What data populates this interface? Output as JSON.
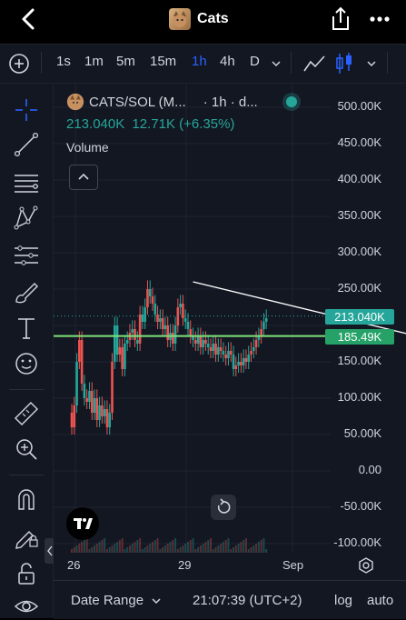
{
  "nav": {
    "title": "Cats"
  },
  "timeframes": [
    "1s",
    "1m",
    "5m",
    "15m",
    "1h",
    "4h",
    "D"
  ],
  "active_timeframe": "1h",
  "legend": {
    "symbol": "CATS/SOL (M...",
    "interval": "· 1h · d...",
    "price": "213.040K",
    "change": "12.71K (+6.35%)",
    "volume_label": "Volume"
  },
  "price_badges": {
    "last": "213.040K",
    "line": "185.49K"
  },
  "colors": {
    "up": "#26a69a",
    "down": "#ef5350",
    "accent": "#2962ff",
    "line_badge": "#26a269",
    "background": "#131722"
  },
  "bottom": {
    "date_range": "Date Range",
    "time": "21:07:39 (UTC+2)",
    "log": "log",
    "auto": "auto"
  },
  "chart_data": {
    "type": "candlestick",
    "y_tick_labels": [
      "500.00K",
      "450.00K",
      "400.00K",
      "350.00K",
      "300.00K",
      "250.00K",
      "200.00K",
      "150.00K",
      "100.00K",
      "50.00K",
      "0.00",
      "-50.00K",
      "-100.00K"
    ],
    "x_tick_labels": [
      "26",
      "29",
      "Sep"
    ],
    "ylim": [
      -100000,
      500000
    ],
    "horizontal_line": 185490,
    "last_price": 213040,
    "trendline": [
      [
        0.24,
        260000
      ],
      [
        0.65,
        180000
      ]
    ],
    "candles": [
      [
        0,
        0.0,
        60000
      ],
      [
        0,
        0.005,
        90000
      ],
      [
        1,
        0.01,
        150000
      ],
      [
        0,
        0.015,
        180000
      ],
      [
        0,
        0.02,
        120000
      ],
      [
        1,
        0.025,
        100000
      ],
      [
        0,
        0.03,
        95000
      ],
      [
        1,
        0.035,
        110000
      ],
      [
        0,
        0.04,
        80000
      ],
      [
        1,
        0.045,
        100000
      ],
      [
        0,
        0.05,
        70000
      ],
      [
        1,
        0.055,
        90000
      ],
      [
        0,
        0.06,
        75000
      ],
      [
        1,
        0.065,
        85000
      ],
      [
        0,
        0.07,
        60000
      ],
      [
        1,
        0.075,
        80000
      ],
      [
        0,
        0.08,
        150000
      ],
      [
        1,
        0.085,
        200000
      ],
      [
        1,
        0.09,
        160000
      ],
      [
        0,
        0.095,
        170000
      ],
      [
        0,
        0.1,
        140000
      ],
      [
        1,
        0.105,
        175000
      ],
      [
        1,
        0.11,
        180000
      ],
      [
        0,
        0.115,
        190000
      ],
      [
        1,
        0.12,
        195000
      ],
      [
        0,
        0.125,
        180000
      ],
      [
        1,
        0.13,
        175000
      ],
      [
        0,
        0.135,
        215000
      ],
      [
        1,
        0.14,
        205000
      ],
      [
        1,
        0.145,
        225000
      ],
      [
        0,
        0.15,
        250000
      ],
      [
        1,
        0.155,
        240000
      ],
      [
        0,
        0.16,
        230000
      ],
      [
        1,
        0.165,
        215000
      ],
      [
        0,
        0.17,
        205000
      ],
      [
        1,
        0.175,
        210000
      ],
      [
        0,
        0.18,
        195000
      ],
      [
        1,
        0.185,
        200000
      ],
      [
        0,
        0.19,
        180000
      ],
      [
        1,
        0.195,
        190000
      ],
      [
        0,
        0.2,
        175000
      ],
      [
        1,
        0.205,
        200000
      ],
      [
        0,
        0.21,
        225000
      ],
      [
        1,
        0.215,
        230000
      ],
      [
        0,
        0.22,
        210000
      ],
      [
        1,
        0.225,
        205000
      ],
      [
        1,
        0.23,
        195000
      ],
      [
        0,
        0.235,
        185000
      ],
      [
        1,
        0.24,
        180000
      ],
      [
        0,
        0.245,
        175000
      ],
      [
        1,
        0.25,
        185000
      ],
      [
        0,
        0.255,
        170000
      ],
      [
        1,
        0.26,
        180000
      ],
      [
        0,
        0.265,
        175000
      ],
      [
        1,
        0.27,
        170000
      ],
      [
        0,
        0.275,
        165000
      ],
      [
        1,
        0.28,
        175000
      ],
      [
        0,
        0.285,
        160000
      ],
      [
        1,
        0.29,
        170000
      ],
      [
        0,
        0.295,
        165000
      ],
      [
        1,
        0.3,
        160000
      ],
      [
        0,
        0.305,
        155000
      ],
      [
        1,
        0.31,
        165000
      ],
      [
        0,
        0.315,
        160000
      ],
      [
        1,
        0.32,
        140000
      ],
      [
        0,
        0.325,
        145000
      ],
      [
        1,
        0.33,
        150000
      ],
      [
        0,
        0.335,
        145000
      ],
      [
        1,
        0.34,
        155000
      ],
      [
        0,
        0.345,
        150000
      ],
      [
        1,
        0.35,
        160000
      ],
      [
        0,
        0.355,
        165000
      ],
      [
        1,
        0.36,
        170000
      ],
      [
        0,
        0.365,
        180000
      ],
      [
        1,
        0.37,
        185000
      ],
      [
        0,
        0.375,
        195000
      ],
      [
        1,
        0.38,
        205000
      ],
      [
        1,
        0.385,
        210000
      ]
    ]
  }
}
